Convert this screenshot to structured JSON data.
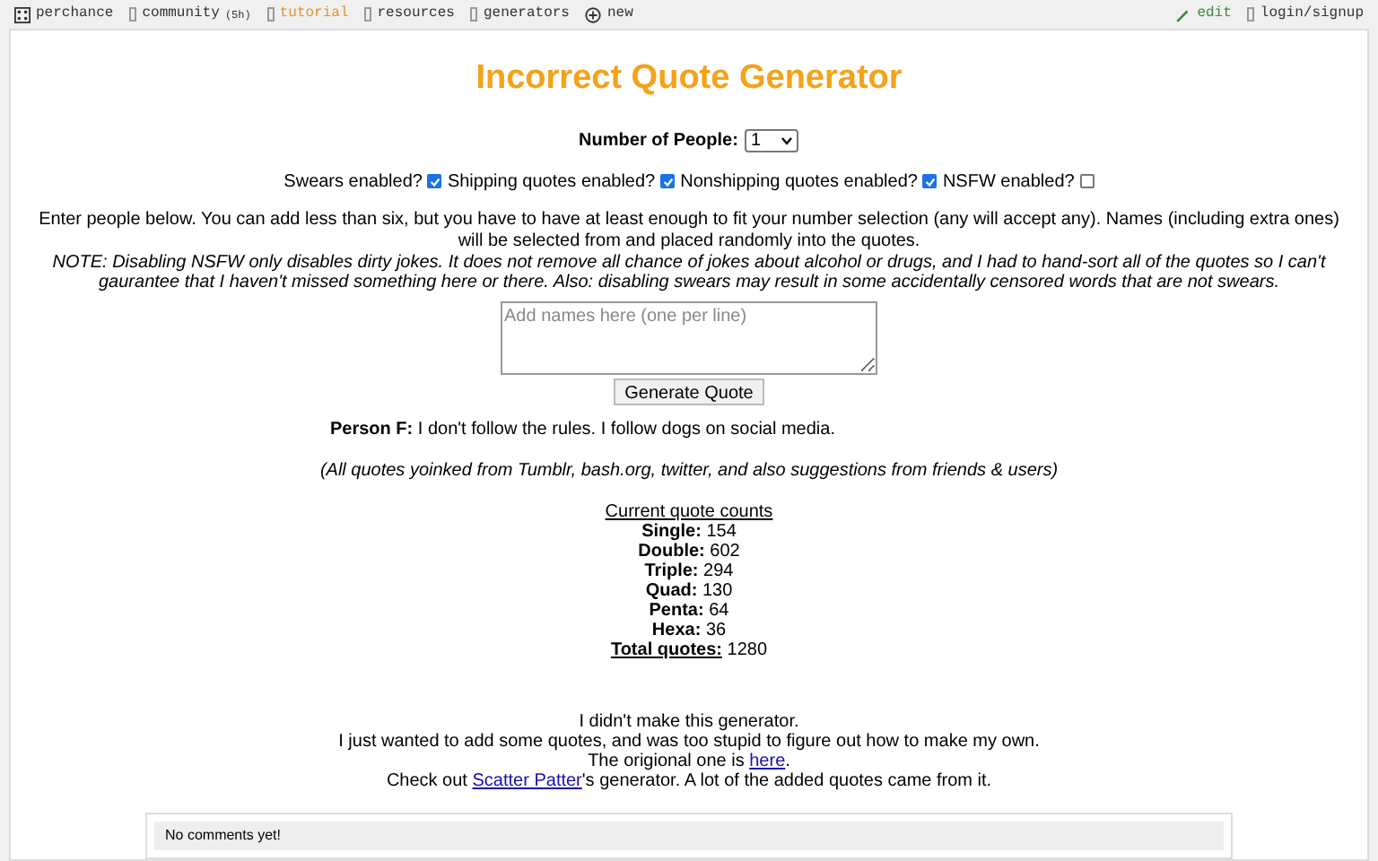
{
  "nav": {
    "left": [
      {
        "kind": "dice",
        "label": "perchance",
        "selected": false
      },
      {
        "kind": "chat",
        "label": "community",
        "extra": "(5h)",
        "selected": false
      },
      {
        "kind": "book",
        "label": "tutorial",
        "selected": true
      },
      {
        "kind": "box",
        "label": "resources",
        "selected": false
      },
      {
        "kind": "box",
        "label": "generators",
        "selected": false
      },
      {
        "kind": "plus",
        "label": "new",
        "selected": false
      }
    ],
    "right": [
      {
        "kind": "pencil",
        "label": "edit"
      },
      {
        "kind": "box",
        "label": "login/signup"
      }
    ]
  },
  "title": "Incorrect Quote Generator",
  "people": {
    "label": "Number of People:",
    "value": "1"
  },
  "toggles": [
    {
      "label": "Swears enabled?",
      "checked": true
    },
    {
      "label": "Shipping quotes enabled?",
      "checked": true
    },
    {
      "label": "Nonshipping quotes enabled?",
      "checked": true
    },
    {
      "label": "NSFW enabled?",
      "checked": false
    }
  ],
  "instructions": "Enter people below. You can add less than six, but you have to have at least enough to fit your number selection (any will accept any). Names (including extra ones) will be selected from and placed randomly into the quotes.",
  "note": "NOTE: Disabling NSFW only disables dirty jokes. It does not remove all chance of jokes about alcohol or drugs, and I had to hand-sort all of the quotes so I can't gaurantee that I haven't missed something here or there. Also: disabling swears may result in some accidentally censored words that are not swears.",
  "names_field": {
    "placeholder": "Add names here (one per line)"
  },
  "generate_button": "Generate Quote",
  "quote": "**Person F:** I don't follow the rules. I follow dogs on social media.",
  "source_note": "(All quotes yoinked from Tumblr, bash.org, twitter, and also suggestions from friends & users)",
  "counts": {
    "heading": "Current quote counts",
    "rows": [
      {
        "label": "Single:",
        "value": "154"
      },
      {
        "label": "Double:",
        "value": "602"
      },
      {
        "label": "Triple:",
        "value": "294"
      },
      {
        "label": "Quad:",
        "value": "130"
      },
      {
        "label": "Penta:",
        "value": "64"
      },
      {
        "label": "Hexa:",
        "value": "36"
      }
    ],
    "total": {
      "label": "Total quotes:",
      "value": "1280"
    }
  },
  "footer": [
    [
      {
        "kind": "text",
        "text": "I didn't make this generator."
      }
    ],
    [
      {
        "kind": "text",
        "text": "I just wanted to add some quotes, and was too stupid to figure out how to make my own."
      }
    ],
    [
      {
        "kind": "text",
        "text": "The origional one is "
      },
      {
        "kind": "link",
        "text": "here"
      },
      {
        "kind": "text",
        "text": "."
      }
    ],
    [
      {
        "kind": "text",
        "text": "Check out "
      },
      {
        "kind": "link",
        "text": "Scatter Patter"
      },
      {
        "kind": "text",
        "text": "'s generator. A lot of the added quotes came from it."
      }
    ]
  ],
  "comments": {
    "empty": "No comments yet!"
  }
}
